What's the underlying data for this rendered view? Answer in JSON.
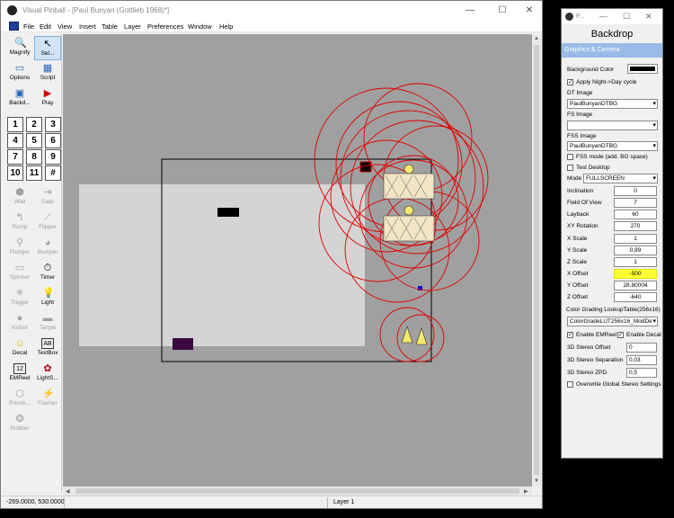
{
  "window": {
    "title": "Visual Pinball - [Paul Bunyan (Gottlieb 1968)*]",
    "menu": [
      "File",
      "Edit",
      "View",
      "Insert",
      "Table",
      "Layer",
      "Preferences",
      "Window",
      "Help"
    ],
    "controls": {
      "minimize": "—",
      "maximize": "☐",
      "close": "✕"
    }
  },
  "toolbox": {
    "top_tools": [
      {
        "label": "Magnify",
        "icon": "magnify-icon"
      },
      {
        "label": "Sel...",
        "icon": "select-arrow-icon"
      },
      {
        "label": "Options",
        "icon": "options-icon"
      },
      {
        "label": "Script",
        "icon": "script-icon"
      },
      {
        "label": "Backd...",
        "icon": "backdrop-icon"
      },
      {
        "label": "Play",
        "icon": "play-icon"
      }
    ],
    "num_keys": [
      "1",
      "2",
      "3",
      "4",
      "5",
      "6",
      "7",
      "8",
      "9",
      "10",
      "11",
      "#"
    ],
    "tools": [
      {
        "label": "Wall",
        "enabled": false
      },
      {
        "label": "Gate",
        "enabled": false
      },
      {
        "label": "Ramp",
        "enabled": false
      },
      {
        "label": "Flipper",
        "enabled": false
      },
      {
        "label": "Plunger",
        "enabled": false
      },
      {
        "label": "Bumper",
        "enabled": false
      },
      {
        "label": "Spinner",
        "enabled": false
      },
      {
        "label": "Timer",
        "enabled": true
      },
      {
        "label": "Trigger",
        "enabled": false
      },
      {
        "label": "Light",
        "enabled": true
      },
      {
        "label": "Kicker",
        "enabled": false
      },
      {
        "label": "Target",
        "enabled": false
      },
      {
        "label": "Decal",
        "enabled": true
      },
      {
        "label": "TextBox",
        "enabled": true
      },
      {
        "label": "EMReel",
        "enabled": true
      },
      {
        "label": "LightS...",
        "enabled": true
      },
      {
        "label": "Primiti...",
        "enabled": false
      },
      {
        "label": "Flasher",
        "enabled": false
      },
      {
        "label": "Rubber",
        "enabled": false
      }
    ]
  },
  "status": {
    "coords": "-269.0000, 530.0000",
    "layer": "Layer 1"
  },
  "props": {
    "window_title": "P...",
    "header": "Backdrop",
    "section": "Graphics & Camera",
    "background_color_label": "Background Color",
    "background_color": "#000000",
    "apply_night_day": "Apply Night->Day cycle",
    "dt_image_label": "DT Image",
    "dt_image": "PaulBunyanDTBG",
    "fs_image_label": "FS Image",
    "fs_image": "",
    "fss_image_label": "FSS Image",
    "fss_image": "PaulBunyanDTBG",
    "fss_mode": "FSS mode (add. BG space)",
    "test_desktop": "Test Desktop",
    "mode_label": "Mode",
    "mode": "FULLSCREEN",
    "fields": [
      {
        "label": "Inclination",
        "value": "0"
      },
      {
        "label": "Field Of View",
        "value": "7"
      },
      {
        "label": "Layback",
        "value": "60"
      },
      {
        "label": "XY Rotation",
        "value": "270"
      },
      {
        "label": "X Scale",
        "value": "1"
      },
      {
        "label": "Y Scale",
        "value": "0,89"
      },
      {
        "label": "Z Scale",
        "value": "1"
      },
      {
        "label": "X Offset",
        "value": "-500"
      },
      {
        "label": "Y Offset",
        "value": "28,80004"
      },
      {
        "label": "Z Offset",
        "value": "-640"
      }
    ],
    "color_grading_label": "Color Grading LookupTable(256x16)",
    "color_grading": "ColorGradeLUT256x16_ModDe",
    "enable_emreel": "Enable EMReel",
    "enable_decal": "Enable Decal",
    "stereo_offset_label": "3D Stereo Offset",
    "stereo_offset": "0",
    "stereo_sep_label": "3D Stereo Separation",
    "stereo_sep": "0,03",
    "stereo_zpd_label": "3D Stereo ZPD",
    "stereo_zpd": "0,5",
    "overwrite_stereo": "Overwrite Global Stereo Settings"
  }
}
